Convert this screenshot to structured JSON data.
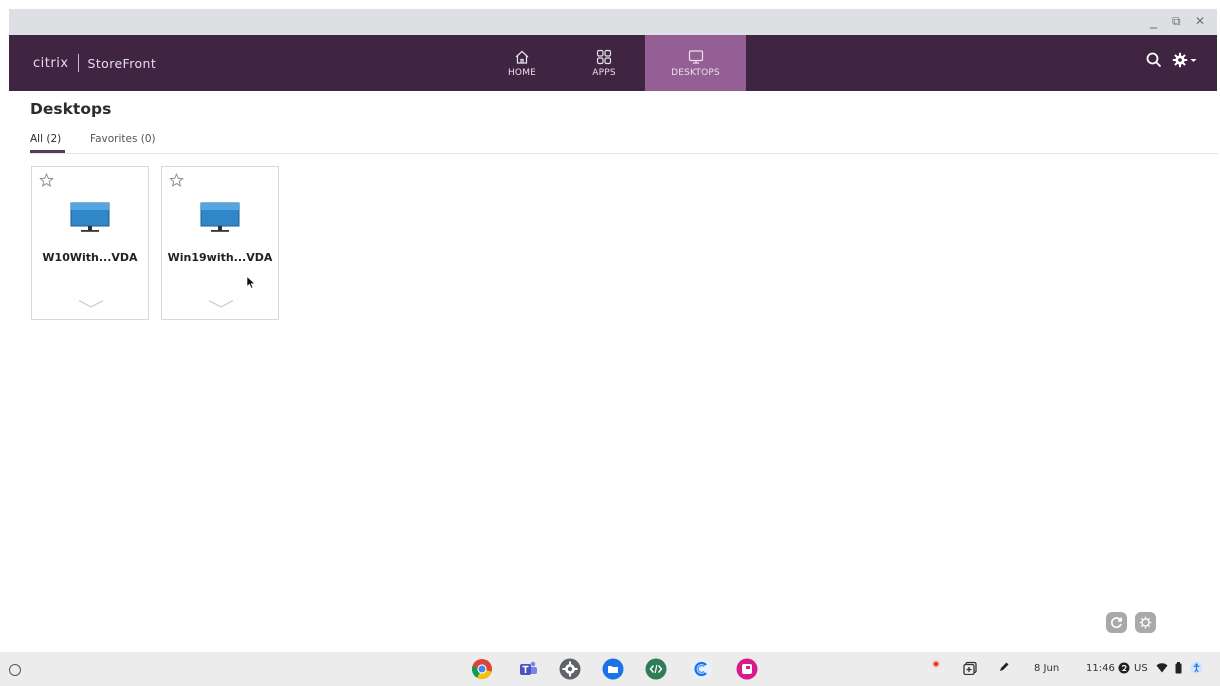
{
  "window": {
    "minimize": "_",
    "restore": "⧉",
    "close": "✕"
  },
  "brand": {
    "citrix": "citrix",
    "product": "StoreFront"
  },
  "nav": {
    "tabs": [
      {
        "label": "HOME",
        "icon": "home-icon",
        "active": false
      },
      {
        "label": "APPS",
        "icon": "apps-grid-icon",
        "active": false
      },
      {
        "label": "DESKTOPS",
        "icon": "monitor-icon",
        "active": true
      }
    ],
    "search_icon": "search-icon",
    "settings_icon": "gear-icon",
    "active_color": "#945f95",
    "bar_color": "#3f2542"
  },
  "page": {
    "title": "Desktops",
    "filters": [
      {
        "label": "All (2)",
        "selected": true
      },
      {
        "label": "Favorites (0)",
        "selected": false
      }
    ]
  },
  "desktops": [
    {
      "name": "W10With...VDA",
      "favorite": false
    },
    {
      "name": "Win19with...VDA",
      "favorite": false
    }
  ],
  "corner_buttons": {
    "refresh": "refresh-icon",
    "settings": "gear-icon"
  },
  "shelf": {
    "apps": [
      "chrome",
      "teams",
      "settings",
      "files",
      "code-editor",
      "citrix-workspace",
      "screencast"
    ],
    "date": "8 Jun",
    "time": "11:46",
    "locale": "US"
  }
}
